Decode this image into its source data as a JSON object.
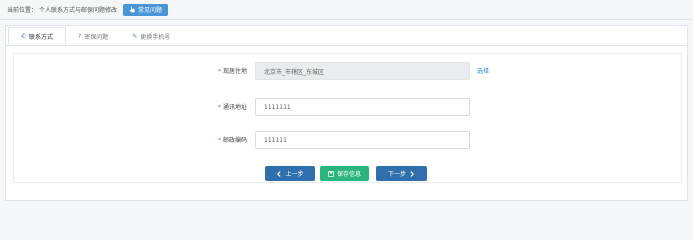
{
  "breadcrumb": {
    "label": "当前位置：",
    "current": "个人联系方式与邮保问题修改"
  },
  "help_button": {
    "label": "常见问题",
    "icon": "hand-pointer-icon"
  },
  "tabs": [
    {
      "label": "联系方式",
      "icon": "phone-icon",
      "active": true
    },
    {
      "label": "密保问题",
      "icon": "question-icon",
      "active": false
    },
    {
      "label": "更换手机号",
      "icon": "pencil-icon",
      "active": false
    }
  ],
  "form": {
    "region": {
      "label": "现居住地",
      "value": "北京市_市辖区_东城区",
      "action": "选择"
    },
    "address": {
      "label": "通讯地址",
      "value": "1111111"
    },
    "postcode": {
      "label": "邮政编码",
      "value": "111111"
    }
  },
  "buttons": {
    "prev": "上一步",
    "save": "保存信息",
    "next": "下一步"
  },
  "colors": {
    "primary_button": "#2f6fae",
    "save_button": "#2bb47e",
    "help_button": "#4a95d6",
    "required_star": "#d9534f",
    "link": "#2b7ccb"
  }
}
